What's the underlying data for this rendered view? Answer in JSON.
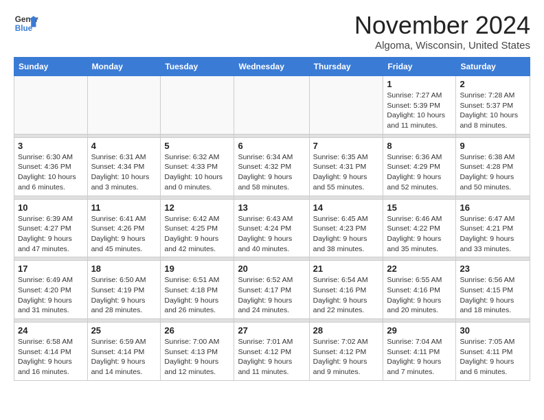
{
  "header": {
    "logo_general": "General",
    "logo_blue": "Blue",
    "month_title": "November 2024",
    "location": "Algoma, Wisconsin, United States"
  },
  "weekdays": [
    "Sunday",
    "Monday",
    "Tuesday",
    "Wednesday",
    "Thursday",
    "Friday",
    "Saturday"
  ],
  "weeks": [
    [
      {
        "day": "",
        "info": ""
      },
      {
        "day": "",
        "info": ""
      },
      {
        "day": "",
        "info": ""
      },
      {
        "day": "",
        "info": ""
      },
      {
        "day": "",
        "info": ""
      },
      {
        "day": "1",
        "info": "Sunrise: 7:27 AM\nSunset: 5:39 PM\nDaylight: 10 hours and 11 minutes."
      },
      {
        "day": "2",
        "info": "Sunrise: 7:28 AM\nSunset: 5:37 PM\nDaylight: 10 hours and 8 minutes."
      }
    ],
    [
      {
        "day": "3",
        "info": "Sunrise: 6:30 AM\nSunset: 4:36 PM\nDaylight: 10 hours and 6 minutes."
      },
      {
        "day": "4",
        "info": "Sunrise: 6:31 AM\nSunset: 4:34 PM\nDaylight: 10 hours and 3 minutes."
      },
      {
        "day": "5",
        "info": "Sunrise: 6:32 AM\nSunset: 4:33 PM\nDaylight: 10 hours and 0 minutes."
      },
      {
        "day": "6",
        "info": "Sunrise: 6:34 AM\nSunset: 4:32 PM\nDaylight: 9 hours and 58 minutes."
      },
      {
        "day": "7",
        "info": "Sunrise: 6:35 AM\nSunset: 4:31 PM\nDaylight: 9 hours and 55 minutes."
      },
      {
        "day": "8",
        "info": "Sunrise: 6:36 AM\nSunset: 4:29 PM\nDaylight: 9 hours and 52 minutes."
      },
      {
        "day": "9",
        "info": "Sunrise: 6:38 AM\nSunset: 4:28 PM\nDaylight: 9 hours and 50 minutes."
      }
    ],
    [
      {
        "day": "10",
        "info": "Sunrise: 6:39 AM\nSunset: 4:27 PM\nDaylight: 9 hours and 47 minutes."
      },
      {
        "day": "11",
        "info": "Sunrise: 6:41 AM\nSunset: 4:26 PM\nDaylight: 9 hours and 45 minutes."
      },
      {
        "day": "12",
        "info": "Sunrise: 6:42 AM\nSunset: 4:25 PM\nDaylight: 9 hours and 42 minutes."
      },
      {
        "day": "13",
        "info": "Sunrise: 6:43 AM\nSunset: 4:24 PM\nDaylight: 9 hours and 40 minutes."
      },
      {
        "day": "14",
        "info": "Sunrise: 6:45 AM\nSunset: 4:23 PM\nDaylight: 9 hours and 38 minutes."
      },
      {
        "day": "15",
        "info": "Sunrise: 6:46 AM\nSunset: 4:22 PM\nDaylight: 9 hours and 35 minutes."
      },
      {
        "day": "16",
        "info": "Sunrise: 6:47 AM\nSunset: 4:21 PM\nDaylight: 9 hours and 33 minutes."
      }
    ],
    [
      {
        "day": "17",
        "info": "Sunrise: 6:49 AM\nSunset: 4:20 PM\nDaylight: 9 hours and 31 minutes."
      },
      {
        "day": "18",
        "info": "Sunrise: 6:50 AM\nSunset: 4:19 PM\nDaylight: 9 hours and 28 minutes."
      },
      {
        "day": "19",
        "info": "Sunrise: 6:51 AM\nSunset: 4:18 PM\nDaylight: 9 hours and 26 minutes."
      },
      {
        "day": "20",
        "info": "Sunrise: 6:52 AM\nSunset: 4:17 PM\nDaylight: 9 hours and 24 minutes."
      },
      {
        "day": "21",
        "info": "Sunrise: 6:54 AM\nSunset: 4:16 PM\nDaylight: 9 hours and 22 minutes."
      },
      {
        "day": "22",
        "info": "Sunrise: 6:55 AM\nSunset: 4:16 PM\nDaylight: 9 hours and 20 minutes."
      },
      {
        "day": "23",
        "info": "Sunrise: 6:56 AM\nSunset: 4:15 PM\nDaylight: 9 hours and 18 minutes."
      }
    ],
    [
      {
        "day": "24",
        "info": "Sunrise: 6:58 AM\nSunset: 4:14 PM\nDaylight: 9 hours and 16 minutes."
      },
      {
        "day": "25",
        "info": "Sunrise: 6:59 AM\nSunset: 4:14 PM\nDaylight: 9 hours and 14 minutes."
      },
      {
        "day": "26",
        "info": "Sunrise: 7:00 AM\nSunset: 4:13 PM\nDaylight: 9 hours and 12 minutes."
      },
      {
        "day": "27",
        "info": "Sunrise: 7:01 AM\nSunset: 4:12 PM\nDaylight: 9 hours and 11 minutes."
      },
      {
        "day": "28",
        "info": "Sunrise: 7:02 AM\nSunset: 4:12 PM\nDaylight: 9 hours and 9 minutes."
      },
      {
        "day": "29",
        "info": "Sunrise: 7:04 AM\nSunset: 4:11 PM\nDaylight: 9 hours and 7 minutes."
      },
      {
        "day": "30",
        "info": "Sunrise: 7:05 AM\nSunset: 4:11 PM\nDaylight: 9 hours and 6 minutes."
      }
    ]
  ]
}
